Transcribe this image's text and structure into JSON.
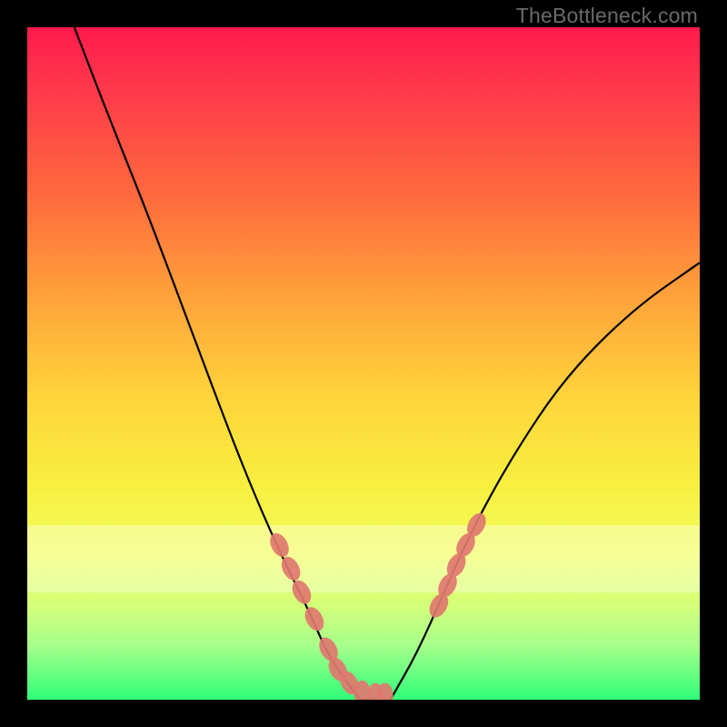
{
  "watermark": "TheBottleneck.com",
  "chart_data": {
    "type": "line",
    "title": "",
    "xlabel": "",
    "ylabel": "",
    "xlim": [
      0,
      100
    ],
    "ylim": [
      0,
      100
    ],
    "left_branch": {
      "x": [
        7,
        12,
        18,
        24,
        30,
        34,
        38,
        42,
        45,
        49.5
      ],
      "y": [
        100,
        87,
        72,
        56,
        40,
        30,
        21,
        13,
        6,
        0
      ]
    },
    "right_branch": {
      "x": [
        54,
        58,
        62,
        66,
        72,
        80,
        90,
        100
      ],
      "y": [
        0,
        7,
        16,
        25,
        36,
        48,
        58,
        65
      ]
    },
    "bottom_flat": {
      "x": [
        49.5,
        54
      ],
      "y": [
        0,
        0
      ]
    },
    "markers_left": {
      "x": [
        37.5,
        39.2,
        40.8,
        42.7,
        44.8,
        46.2,
        47.9,
        49.8,
        51.8,
        53.2
      ],
      "y": [
        23,
        19.5,
        16,
        12,
        7.5,
        4.5,
        2.5,
        1,
        0.6,
        0.6
      ]
    },
    "markers_right": {
      "x": [
        61.2,
        62.5,
        63.8,
        65.2,
        66.8
      ],
      "y": [
        14,
        17,
        20,
        23,
        26
      ]
    },
    "marker_color": "#e0786f",
    "pale_band_y": [
      74,
      84
    ]
  }
}
